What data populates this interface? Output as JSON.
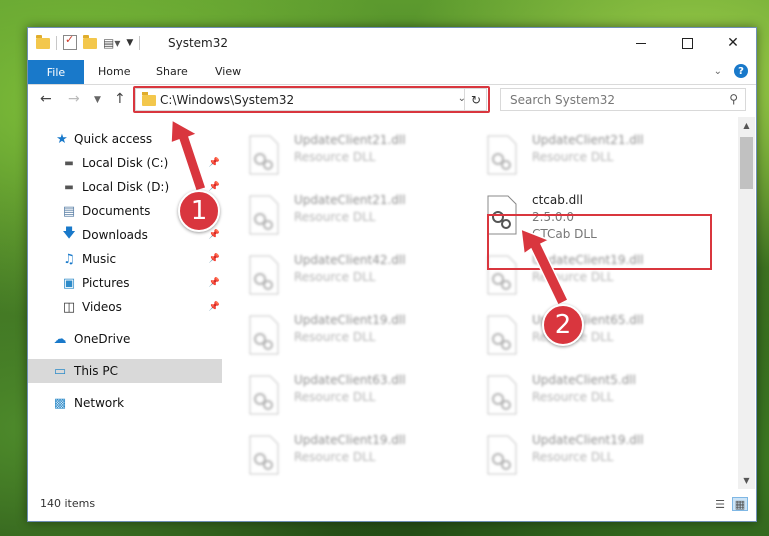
{
  "window": {
    "title": "System32",
    "min_icon": "minimize-icon",
    "max_icon": "maximize-icon",
    "close_icon": "close-icon"
  },
  "ribbon": {
    "file": "File",
    "tabs": [
      "Home",
      "Share",
      "View"
    ]
  },
  "address": {
    "path": "C:\\Windows\\System32",
    "search_placeholder": "Search System32"
  },
  "nav": {
    "items": [
      {
        "label": "Quick access",
        "icon": "star-icon"
      },
      {
        "label": "Local Disk (C:)",
        "icon": "drive-icon",
        "pinned": true
      },
      {
        "label": "Local Disk (D:)",
        "icon": "drive-icon",
        "pinned": true
      },
      {
        "label": "Documents",
        "icon": "documents-icon",
        "pinned": true
      },
      {
        "label": "Downloads",
        "icon": "downloads-icon",
        "pinned": true
      },
      {
        "label": "Music",
        "icon": "music-icon",
        "pinned": true
      },
      {
        "label": "Pictures",
        "icon": "pictures-icon",
        "pinned": true
      },
      {
        "label": "Videos",
        "icon": "videos-icon",
        "pinned": true
      },
      {
        "label": "OneDrive",
        "icon": "cloud-icon"
      },
      {
        "label": "This PC",
        "icon": "computer-icon",
        "selected": true
      },
      {
        "label": "Network",
        "icon": "network-icon"
      }
    ]
  },
  "files": [
    {
      "name": "UpdateClient21.dll",
      "type": "Resource DLL"
    },
    {
      "name": "UpdateClient21.dll",
      "type": "Resource DLL"
    },
    {
      "name": "UpdateClient21.dll",
      "type": "Resource DLL"
    },
    {
      "name": "ctcab.dll",
      "version": "2.5.0.0",
      "type": "CTCab DLL"
    },
    {
      "name": "UpdateClient42.dll",
      "type": "Resource DLL"
    },
    {
      "name": "UpdateClient19.dll",
      "type": "Resource DLL"
    },
    {
      "name": "UpdateClient19.dll",
      "type": "Resource DLL"
    },
    {
      "name": "UpdateClient65.dll",
      "type": "Resource DLL"
    },
    {
      "name": "UpdateClient63.dll",
      "type": "Resource DLL"
    },
    {
      "name": "UpdateClient5.dll",
      "type": "Resource DLL"
    },
    {
      "name": "UpdateClient19.dll",
      "type": "Resource DLL"
    },
    {
      "name": "UpdateClient19.dll",
      "type": "Resource DLL"
    }
  ],
  "status": {
    "count": "140 items"
  },
  "callouts": [
    "1",
    "2"
  ],
  "colors": {
    "accent": "#1979ca",
    "highlight": "#d9363e"
  }
}
